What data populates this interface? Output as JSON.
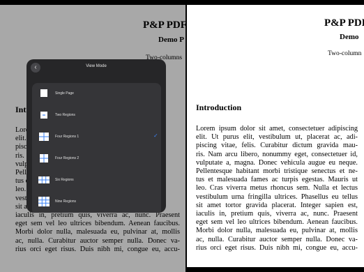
{
  "left_page": {
    "title": "P&P PDF",
    "subtitle": "Demo P",
    "columns_note": "Two-columns",
    "heading": "Intr",
    "lines": [
      "Lore",
      "elit.",
      "pisci",
      "ris.",
      "vulp",
      "Pelle",
      "tus e",
      "leo.",
      "vestib",
      "sit ame",
      "iaculis in, pretium quis, viverra ac, nunc. Praesent",
      "eget sem vel leo ultrices bibendum. Aenean faucibus.",
      "Morbi dolor nulla, malesuada eu, pulvinar at, mollis",
      "ac, nulla. Curabitur auctor semper nulla. Donec va-",
      "rius orci eget risus. Duis nibh mi, congue eu, accu-"
    ]
  },
  "right_page": {
    "title": "P&P PDF",
    "subtitle": "Demo",
    "columns_note": "Two-column",
    "heading": "Introduction",
    "lines": [
      "Lorem ipsum dolor sit amet, consectetuer adipiscing",
      "elit. Ut purus elit, vestibulum ut, placerat ac, adi-",
      "piscing vitae, felis. Curabitur dictum gravida mau-",
      "ris. Nam arcu libero, nonummy eget, consectetuer id,",
      "vulputate a, magna. Donec vehicula augue eu neque.",
      "Pellentesque habitant morbi tristique senectus et ne-",
      "tus et malesuada fames ac turpis egestas. Mauris ut",
      "leo. Cras viverra metus rhoncus sem. Nulla et lectus",
      "vestibulum urna fringilla ultrices. Phasellus eu tellus",
      "sit amet tortor gravida placerat. Integer sapien est,",
      "iaculis in, pretium quis, viverra ac, nunc. Praesent",
      "eget sem vel leo ultrices bibendum. Aenean faucibus.",
      "Morbi dolor nulla, malesuada eu, pulvinar at, mollis",
      "ac, nulla. Curabitur auctor semper nulla. Donec va-",
      "rius orci eget risus. Duis nibh mi, congue eu, accu-"
    ]
  },
  "modal": {
    "title": "View Mode",
    "back_icon": "chevron-left-icon",
    "options": [
      {
        "label": "Single Page",
        "icon": "single-page-icon",
        "selected": false
      },
      {
        "label": "Two Regions",
        "icon": "two-regions-icon",
        "selected": false
      },
      {
        "label": "Four Regions 1",
        "icon": "four-regions-1-icon",
        "selected": true
      },
      {
        "label": "Four Regions 2",
        "icon": "four-regions-2-icon",
        "selected": false
      },
      {
        "label": "Six Regions",
        "icon": "six-regions-icon",
        "selected": false
      },
      {
        "label": "Nine Regions",
        "icon": "nine-regions-icon",
        "selected": false
      }
    ],
    "check_mark": "✓"
  },
  "colors": {
    "modal_bg": "#262628",
    "list_bg": "#353538",
    "check": "#3b82f6",
    "page_bg": "#ffffff"
  }
}
